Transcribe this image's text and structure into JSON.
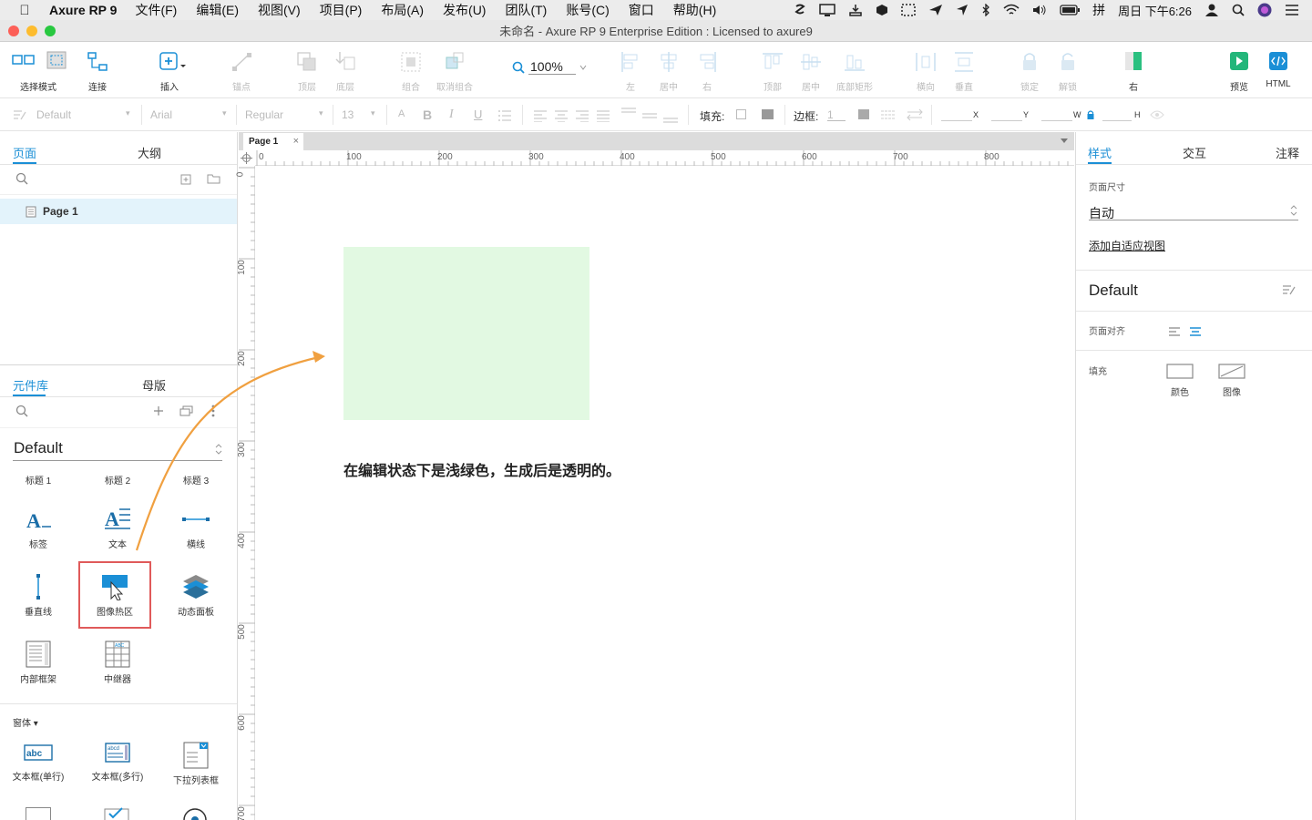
{
  "menubar": {
    "app_name": "Axure RP 9",
    "items": [
      "文件(F)",
      "编辑(E)",
      "视图(V)",
      "项目(P)",
      "布局(A)",
      "发布(U)",
      "团队(T)",
      "账号(C)",
      "窗口",
      "帮助(H)"
    ],
    "clock": "周日 下午6:26"
  },
  "window": {
    "title": "未命名 - Axure RP 9 Enterprise Edition : Licensed to axure9"
  },
  "toolbar": {
    "select_mode": "选择模式",
    "connect": "连接",
    "insert": "插入",
    "point": "锚点",
    "top": "顶层",
    "bottom": "底层",
    "group": "组合",
    "ungroup": "取消组合",
    "zoom": "100%",
    "left": "左",
    "center": "居中",
    "right": "右",
    "top_align": "顶部",
    "middle": "居中",
    "bottom_align": "底部矩形",
    "horizontal": "横向",
    "vertical": "垂直",
    "lock": "锁定",
    "unlock": "解锁",
    "right_panel": "右",
    "preview": "预览",
    "html": "HTML"
  },
  "formatbar": {
    "style": "Default",
    "font": "Arial",
    "weight": "Regular",
    "size": "13",
    "fill_label": "填充:",
    "border_label": "边框:",
    "border_value": "1",
    "x": "X",
    "y": "Y",
    "w": "W",
    "h": "H"
  },
  "left_panel": {
    "tabs": [
      "页面",
      "大纲"
    ],
    "pages": [
      "Page 1"
    ],
    "lib_tabs": [
      "元件库",
      "母版"
    ],
    "library": "Default",
    "widgets": [
      {
        "label": "标题 1"
      },
      {
        "label": "标题 2"
      },
      {
        "label": "标题 3"
      },
      {
        "label": "标签"
      },
      {
        "label": "文本"
      },
      {
        "label": "横线"
      },
      {
        "label": "垂直线"
      },
      {
        "label": "图像热区"
      },
      {
        "label": "动态面板"
      },
      {
        "label": "内部框架"
      },
      {
        "label": "中继器"
      }
    ],
    "forms_header": "窗体",
    "form_widgets": [
      "文本框(单行)",
      "文本框(多行)",
      "下拉列表框"
    ]
  },
  "canvas": {
    "doc_tab": "Page 1",
    "ruler_h": [
      "0",
      "100",
      "200",
      "300",
      "400",
      "500",
      "600",
      "700",
      "800"
    ],
    "ruler_v": [
      "0",
      "100",
      "200",
      "300",
      "400",
      "500",
      "600",
      "700"
    ],
    "note": "在编辑状态下是浅绿色，生成后是透明的。",
    "hotspot_color": "#e2f9e2"
  },
  "right_panel": {
    "tabs": [
      "样式",
      "交互",
      "注释"
    ],
    "page_size_label": "页面尺寸",
    "page_size_value": "自动",
    "add_adaptive": "添加自适应视图",
    "style_name": "Default",
    "page_align_label": "页面对齐",
    "fill_label": "填充",
    "fill_color": "颜色",
    "fill_image": "图像"
  },
  "colors": {
    "accent": "#1b8fd6",
    "highlight_border": "#e05a5a",
    "arrow": "#f0a040"
  }
}
